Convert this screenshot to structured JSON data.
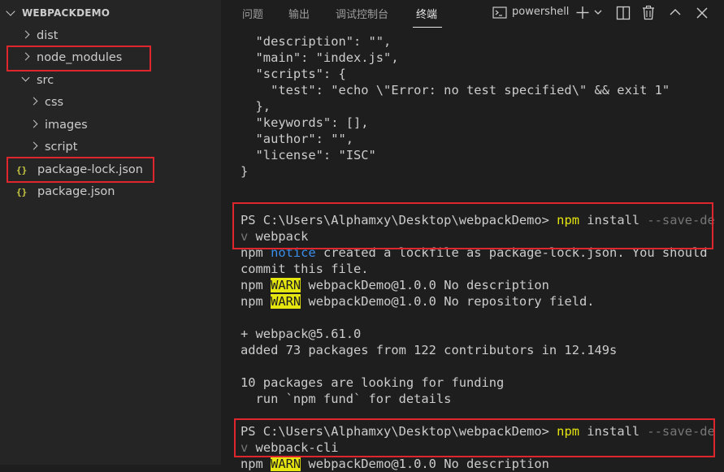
{
  "explorer": {
    "title": "WEBPACKDEMO",
    "items": [
      {
        "label": "dist"
      },
      {
        "label": "node_modules"
      },
      {
        "label": "src"
      },
      {
        "label": "css"
      },
      {
        "label": "images"
      },
      {
        "label": "script"
      },
      {
        "label": "package-lock.json"
      },
      {
        "label": "package.json"
      }
    ],
    "json_icon": "{}"
  },
  "panel": {
    "tabs": [
      {
        "label": "问题"
      },
      {
        "label": "输出"
      },
      {
        "label": "调试控制台"
      },
      {
        "label": "终端"
      }
    ],
    "shell": "powershell"
  },
  "terminal": {
    "json_lines": [
      "  \"description\": \"\",",
      "  \"main\": \"index.js\",",
      "  \"scripts\": {",
      "    \"test\": \"echo \\\"Error: no test specified\\\" && exit 1\"",
      "  },",
      "  \"keywords\": [],",
      "  \"author\": \"\",",
      "  \"license\": \"ISC\"",
      "}"
    ],
    "cmd1": {
      "prompt": "PS C:\\Users\\Alphamxy\\Desktop\\webpackDemo> ",
      "npm": "npm",
      "install": " install ",
      "flag_a": "--save-de",
      "flag_b": "v",
      "pkg": " webpack"
    },
    "notice": {
      "npm": "npm ",
      "tag": "notice",
      "text1": " created a lockfile as package-lock.json. You should",
      "text2": "commit this file."
    },
    "warn1": {
      "npm": "npm ",
      "tag": "WARN",
      "text": " webpackDemo@1.0.0 No description"
    },
    "warn2": {
      "npm": "npm ",
      "tag": "WARN",
      "text": " webpackDemo@1.0.0 No repository field."
    },
    "result_lines": [
      "+ webpack@5.61.0",
      "added 73 packages from 122 contributors in 12.149s"
    ],
    "funding_lines": [
      "10 packages are looking for funding",
      "  run `npm fund` for details"
    ],
    "cmd2": {
      "prompt": "PS C:\\Users\\Alphamxy\\Desktop\\webpackDemo> ",
      "npm": "npm",
      "install": " install ",
      "flag_a": "--save-de",
      "flag_b": "v",
      "pkg": " webpack-cli"
    },
    "warn3": {
      "npm": "npm ",
      "tag": "WARN",
      "text": " webpackDemo@1.0.0 No description"
    }
  }
}
